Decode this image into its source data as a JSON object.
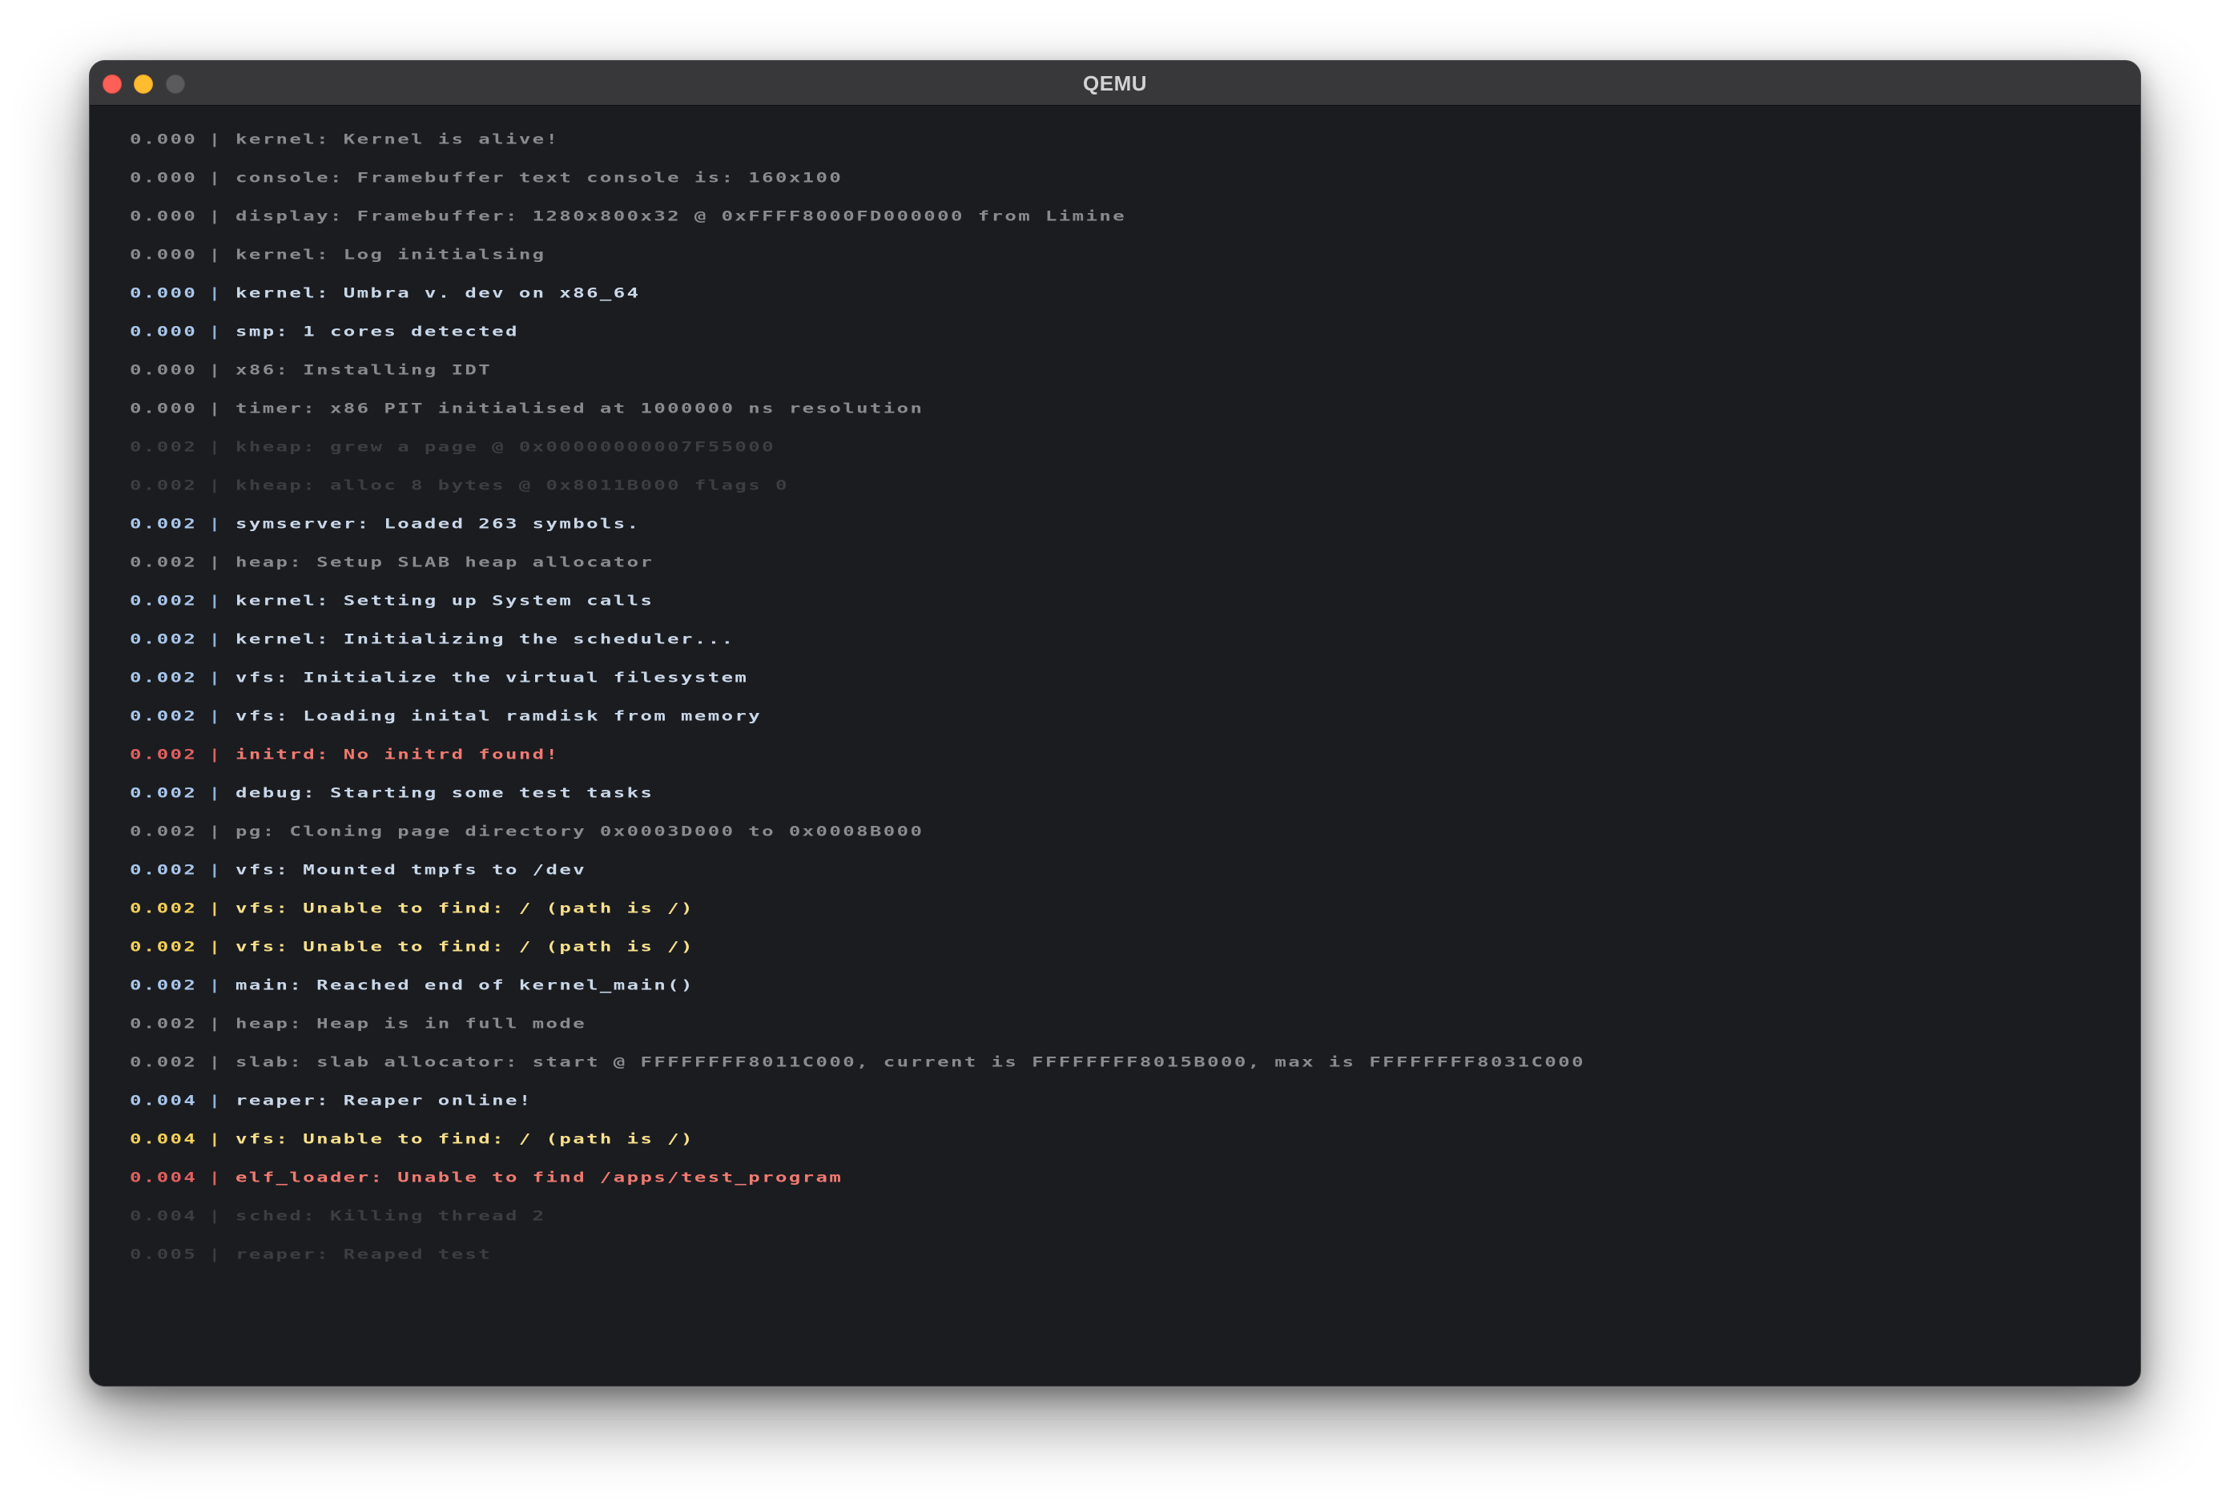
{
  "window": {
    "title": "QEMU"
  },
  "colors": {
    "info": "#c9d7e8",
    "debug": "#8a8a8e",
    "trace": "#3c3d42",
    "error": "#f07a70",
    "warning": "#f7e08a",
    "background": "#1b1c20"
  },
  "log": [
    {
      "time": "0.000",
      "sep": "|",
      "text": "kernel: Kernel is alive!",
      "level": "dim"
    },
    {
      "time": "0.000",
      "sep": "|",
      "text": "console: Framebuffer text console is: 160x100",
      "level": "dim"
    },
    {
      "time": "0.000",
      "sep": "|",
      "text": "display: Framebuffer: 1280x800x32 @ 0xFFFF8000FD000000 from Limine",
      "level": "dim"
    },
    {
      "time": "0.000",
      "sep": "|",
      "text": "kernel: Log initialsing",
      "level": "dim"
    },
    {
      "time": "0.000",
      "sep": "|",
      "text": "kernel: Umbra v. dev on x86_64",
      "level": "info"
    },
    {
      "time": "0.000",
      "sep": "|",
      "text": "smp: 1 cores detected",
      "level": "info"
    },
    {
      "time": "0.000",
      "sep": "|",
      "text": "x86: Installing IDT",
      "level": "dim"
    },
    {
      "time": "0.000",
      "sep": "|",
      "text": "timer: x86 PIT initialised at 1000000 ns resolution",
      "level": "dim"
    },
    {
      "time": "0.002",
      "sep": "|",
      "text": "kheap: grew a page @ 0x00000000007F55000",
      "level": "faint"
    },
    {
      "time": "0.002",
      "sep": "|",
      "text": "kheap: alloc 8 bytes @ 0x8011B000 flags 0",
      "level": "faint"
    },
    {
      "time": "0.002",
      "sep": "|",
      "text": "symserver: Loaded 263 symbols.",
      "level": "info"
    },
    {
      "time": "0.002",
      "sep": "|",
      "text": "heap: Setup SLAB heap allocator",
      "level": "dim"
    },
    {
      "time": "0.002",
      "sep": "|",
      "text": "kernel: Setting up System calls",
      "level": "info"
    },
    {
      "time": "0.002",
      "sep": "|",
      "text": "kernel: Initializing the scheduler...",
      "level": "info"
    },
    {
      "time": "0.002",
      "sep": "|",
      "text": "vfs: Initialize the virtual filesystem",
      "level": "info"
    },
    {
      "time": "0.002",
      "sep": "|",
      "text": "vfs: Loading inital ramdisk from memory",
      "level": "info"
    },
    {
      "time": "0.002",
      "sep": "|",
      "text": "initrd: No initrd found!",
      "level": "err"
    },
    {
      "time": "0.002",
      "sep": "|",
      "text": "debug: Starting some test tasks",
      "level": "info"
    },
    {
      "time": "0.002",
      "sep": "|",
      "text": "pg: Cloning page directory 0x0003D000 to 0x0008B000",
      "level": "dim"
    },
    {
      "time": "0.002",
      "sep": "|",
      "text": "vfs: Mounted tmpfs to /dev",
      "level": "info"
    },
    {
      "time": "0.002",
      "sep": "|",
      "text": "vfs: Unable to find: / (path is /)",
      "level": "warn"
    },
    {
      "time": "0.002",
      "sep": "|",
      "text": "vfs: Unable to find: / (path is /)",
      "level": "warn"
    },
    {
      "time": "0.002",
      "sep": "|",
      "text": "main: Reached end of kernel_main()",
      "level": "info"
    },
    {
      "time": "0.002",
      "sep": "|",
      "text": "heap: Heap is in full mode",
      "level": "dim"
    },
    {
      "time": "0.002",
      "sep": "|",
      "text": "slab: slab allocator: start @ FFFFFFFF8011C000, current is FFFFFFFF8015B000, max is FFFFFFFF8031C000",
      "level": "dim"
    },
    {
      "time": "0.004",
      "sep": "|",
      "text": "reaper: Reaper online!",
      "level": "info"
    },
    {
      "time": "0.004",
      "sep": "|",
      "text": "vfs: Unable to find: / (path is /)",
      "level": "warn"
    },
    {
      "time": "0.004",
      "sep": "|",
      "text": "elf_loader: Unable to find /apps/test_program",
      "level": "err"
    },
    {
      "time": "0.004",
      "sep": "|",
      "text": "sched: Killing thread 2",
      "level": "faint"
    },
    {
      "time": "0.005",
      "sep": "|",
      "text": "reaper: Reaped test",
      "level": "faint"
    }
  ]
}
